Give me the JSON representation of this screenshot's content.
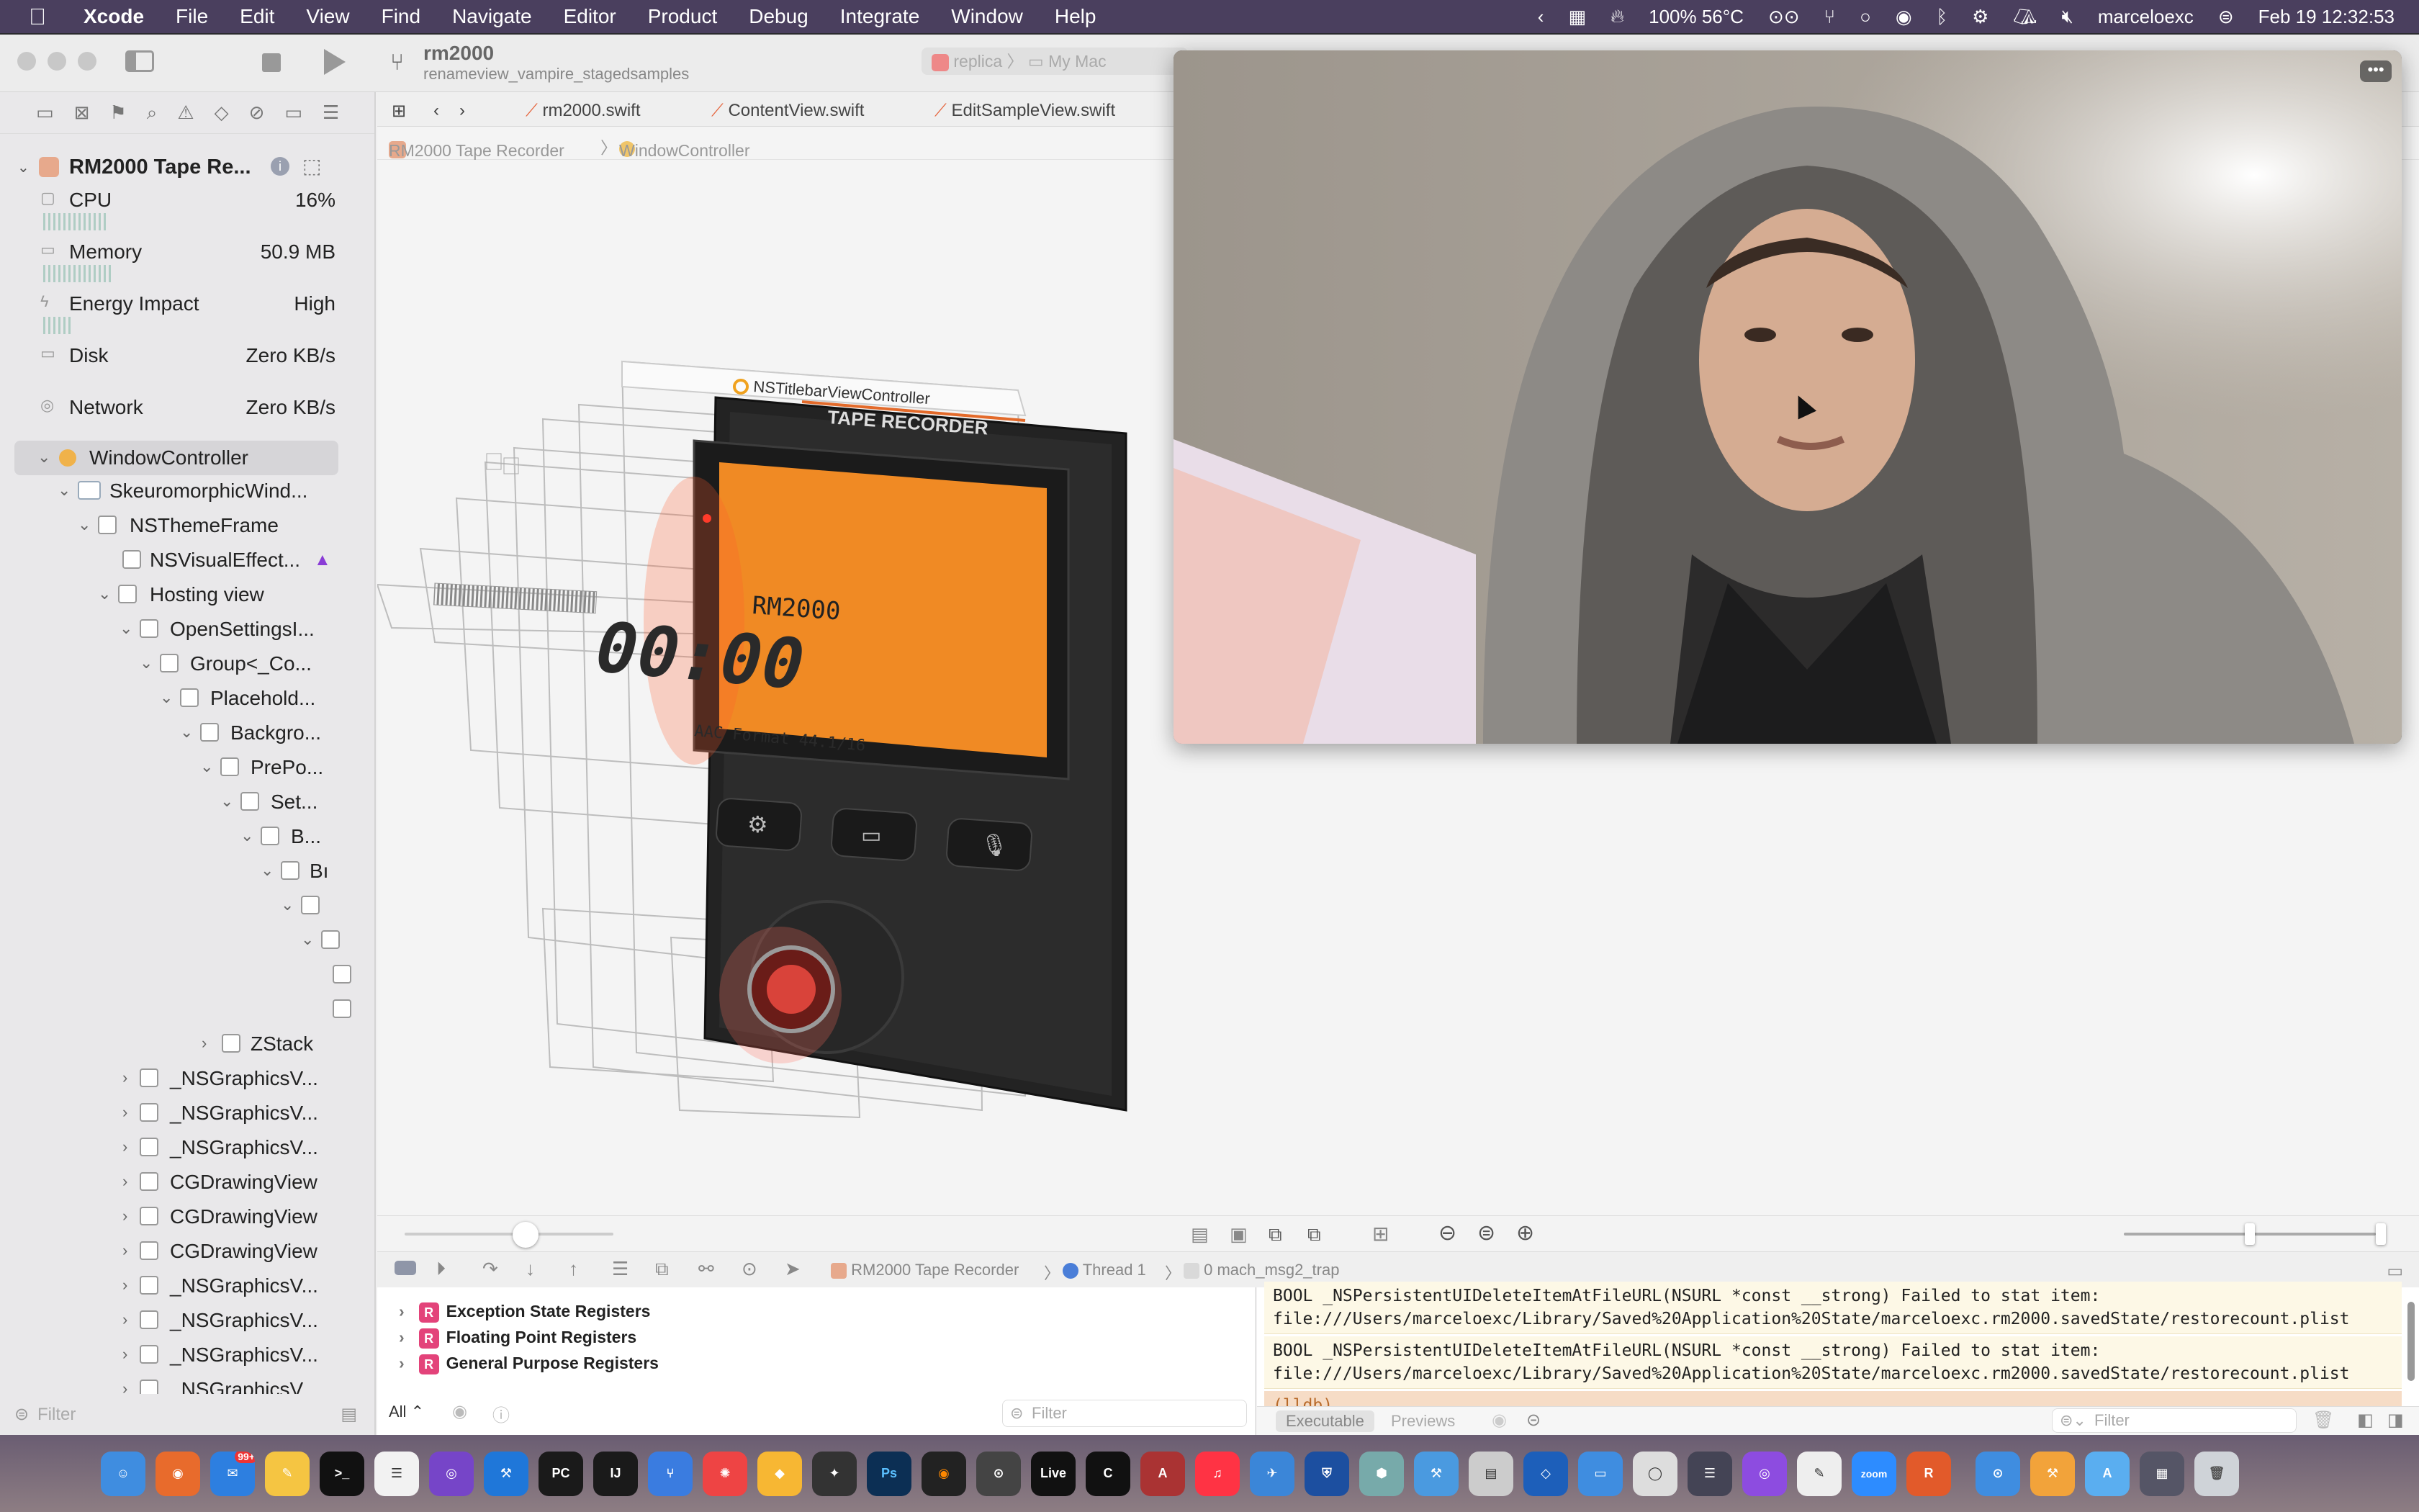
{
  "menubar": {
    "apple": "",
    "app": "Xcode",
    "items": [
      "File",
      "Edit",
      "View",
      "Find",
      "Navigate",
      "Editor",
      "Product",
      "Debug",
      "Integrate",
      "Window",
      "Help"
    ],
    "battery": "100% 56°C",
    "user": "marceloexc",
    "datetime": "Feb 19 12:32:53"
  },
  "toolbar": {
    "scheme_title": "rm2000",
    "branch": "renameview_vampire_stagedsamples",
    "run_dest_app": "replica",
    "run_dest_device": "My Mac"
  },
  "navigator": {
    "project": "RM2000 Tape Re...",
    "gauges": [
      {
        "label": "CPU",
        "value": "16%"
      },
      {
        "label": "Memory",
        "value": "50.9 MB"
      },
      {
        "label": "Energy Impact",
        "value": "High"
      },
      {
        "label": "Disk",
        "value": "Zero KB/s"
      },
      {
        "label": "Network",
        "value": "Zero KB/s"
      }
    ],
    "tree": [
      "WindowController",
      "SkeuromorphicWind...",
      "NSThemeFrame",
      "NSVisualEffect...",
      "Hosting view",
      "OpenSettingsI...",
      "Group<_Co...",
      "Placehold...",
      "Backgro...",
      "PrePo...",
      "Set...",
      "B...",
      "Bı",
      "",
      "",
      "",
      "",
      "ZStack",
      "_NSGraphicsV...",
      "_NSGraphicsV...",
      "_NSGraphicsV...",
      "CGDrawingView",
      "CGDrawingView",
      "CGDrawingView",
      "_NSGraphicsV...",
      "_NSGraphicsV...",
      "_NSGraphicsV...",
      "_NSGraphicsV..."
    ],
    "filter_placeholder": "Filter"
  },
  "editor": {
    "tabs": [
      "rm2000.swift",
      "ContentView.swift",
      "EditSampleView.swift"
    ],
    "jump": [
      "RM2000 Tape Recorder",
      "WindowController"
    ],
    "canvas": {
      "titlebar_label": "NSTitlebarViewController",
      "device_brand": "TAPE RECORDER",
      "lcd_model": "RM2000",
      "lcd_time": "00:00",
      "lcd_format": "AAC Format 44.1/16"
    }
  },
  "debug": {
    "jump": [
      "RM2000 Tape Recorder",
      "Thread 1",
      "0 mach_msg2_trap"
    ],
    "registers": [
      "Exception State Registers",
      "Floating Point Registers",
      "General Purpose Registers"
    ],
    "console": [
      {
        "line1": "BOOL _NSPersistentUIDeleteItemAtFileURL(NSURL *const __strong) Failed to stat item:",
        "line2": "file:///Users/marceloexc/Library/Saved%20Application%20State/marceloexc.rm2000.savedState/restorecount.plist"
      },
      {
        "line1": "BOOL _NSPersistentUIDeleteItemAtFileURL(NSURL *const __strong) Failed to stat item:",
        "line2": "file:///Users/marceloexc/Library/Saved%20Application%20State/marceloexc.rm2000.savedState/restorecount.plist"
      }
    ],
    "prompt": "(lldb)",
    "vars_scope": "All",
    "filter_placeholder": "Filter",
    "tabs": [
      "Executable",
      "Previews"
    ]
  },
  "dock": {
    "badge": "99+",
    "labels": [
      "PC",
      "IJ",
      "Ps",
      "Live",
      "zoom"
    ]
  }
}
